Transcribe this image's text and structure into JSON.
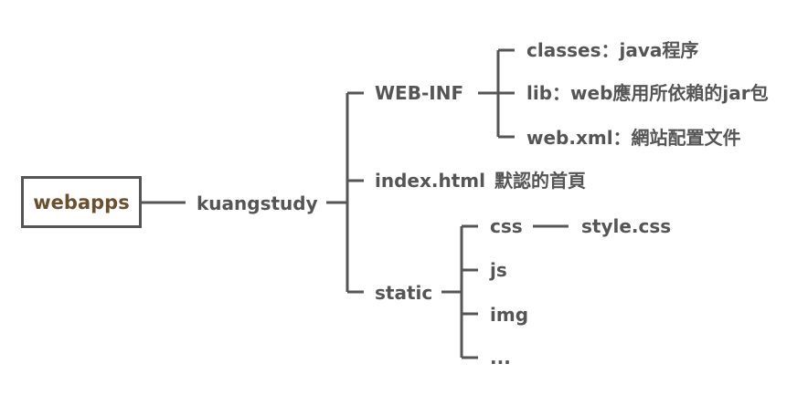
{
  "root": "webapps",
  "project": "kuangstudy",
  "web_inf": {
    "label": "WEB-INF",
    "children": [
      "classes：java程序",
      "lib：web應用所依賴的jar包",
      "web.xml：網站配置文件"
    ]
  },
  "index": {
    "label": "index.html",
    "desc": "默認的首頁"
  },
  "static": {
    "label": "static",
    "children": [
      "css",
      "js",
      "img",
      "..."
    ],
    "css_file": "style.css"
  },
  "colors": {
    "line": "#555555",
    "text": "#555555",
    "root_text": "#6b4f2e"
  }
}
